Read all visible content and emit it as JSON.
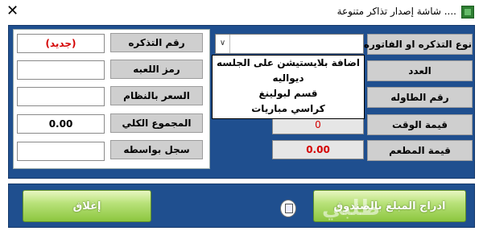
{
  "window": {
    "title": ".... شاشة إصدار تذاكر متنوعة",
    "close_glyph": "✕"
  },
  "left_panel": {
    "ticket_number_label": "رقم التذكره",
    "ticket_number_value": "(جديد)",
    "game_code_label": "رمز اللعبه",
    "game_code_value": "",
    "system_price_label": "السعر بالنظام",
    "system_price_value": "",
    "grand_total_label": "المجموع الكلي",
    "grand_total_value": "0.00",
    "recorded_by_label": "سجل بواسطه",
    "recorded_by_value": ""
  },
  "right_panel": {
    "ticket_type_label": "نوع التذكره او الفاتوره",
    "count_label": "العدد",
    "table_number_label": "رقم الطاوله",
    "time_value_label": "قيمة الوقت",
    "time_value": "0",
    "restaurant_value_label": "قيمة المطعم",
    "restaurant_value": "0.00"
  },
  "combo": {
    "selected": "",
    "options": [
      "اضافة بلايستيشن على الجلسه",
      "ديواليه",
      "قسم لبولينغ",
      "كراسي مباريات"
    ]
  },
  "buttons": {
    "close_label": "إغلاق",
    "deposit_label": "ادراج المبلغ بالصندوق"
  },
  "watermark": "طلبي"
}
